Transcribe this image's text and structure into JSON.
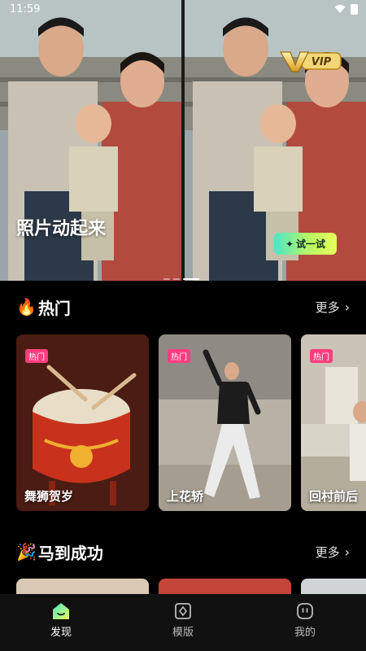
{
  "status_bar": {
    "time": "11:59"
  },
  "hero": {
    "caption": "照片动起来",
    "vip_label": "VIP",
    "try_button": "试一试",
    "try_icon": "sparkle-icon"
  },
  "hot_section": {
    "emoji": "🔥",
    "title": "热门",
    "more_label": "更多"
  },
  "hot_cards": [
    {
      "tag": "热门",
      "title": "舞狮贺岁"
    },
    {
      "tag": "热门",
      "title": "上花轿"
    },
    {
      "tag": "热门",
      "title": "回村前后"
    }
  ],
  "success_section": {
    "emoji": "🎉",
    "title": "马到成功",
    "more_label": "更多"
  },
  "bottom_nav": [
    {
      "label": "发现",
      "icon": "discover-icon",
      "active": true
    },
    {
      "label": "模版",
      "icon": "template-icon",
      "active": false
    },
    {
      "label": "我的",
      "icon": "profile-icon",
      "active": false
    }
  ],
  "colors": {
    "accent_gradient_start": "#4be6c9",
    "accent_gradient_end": "#e8ff5a",
    "hot_tag": "#ff3d7f",
    "background": "#000000"
  }
}
